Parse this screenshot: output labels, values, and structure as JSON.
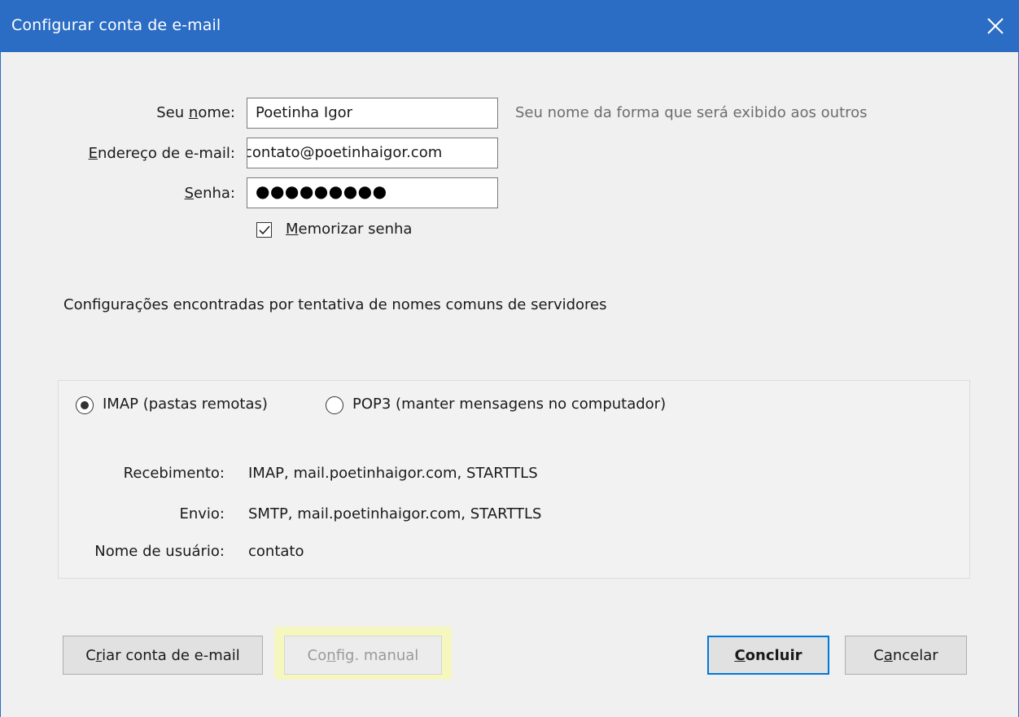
{
  "window": {
    "title": "Configurar conta de e-mail",
    "close_icon": "close-icon"
  },
  "form": {
    "name_label_pre": "Seu ",
    "name_label_acc": "n",
    "name_label_post": "ome:",
    "name_value": "Poetinha Igor",
    "name_hint": "Seu nome da forma que será exibido aos outros",
    "email_label_acc": "E",
    "email_label_post": "ndereço de e-mail:",
    "email_value": "contato@poetinhaigor.com",
    "password_label_acc": "S",
    "password_label_post": "enha:",
    "password_value": "●●●●●●●●●",
    "remember_checked": true,
    "remember_label_acc": "M",
    "remember_label_post": "emorizar senha"
  },
  "status_text": "Configurações encontradas por tentativa de nomes comuns de servidores",
  "protocol": {
    "imap_label": "IMAP (pastas remotas)",
    "pop3_label": "POP3 (manter mensagens no computador)",
    "selected": "IMAP"
  },
  "details": {
    "incoming_label": "Recebimento:",
    "incoming_value": "IMAP, mail.poetinhaigor.com, STARTTLS",
    "outgoing_label": "Envio:",
    "outgoing_value": "SMTP, mail.poetinhaigor.com, STARTTLS",
    "username_label": "Nome de usuário:",
    "username_value": "contato"
  },
  "buttons": {
    "create_pre": "C",
    "create_acc": "r",
    "create_post": "iar conta de e-mail",
    "manual_pre": "Co",
    "manual_acc": "n",
    "manual_post": "fig. manual",
    "done_acc": "C",
    "done_post": "oncluir",
    "cancel_pre": "C",
    "cancel_acc": "a",
    "cancel_post": "ncelar"
  },
  "colors": {
    "titlebar": "#2b6cc4",
    "highlight": "#f6f7bf",
    "focus_border": "#0078d7"
  }
}
